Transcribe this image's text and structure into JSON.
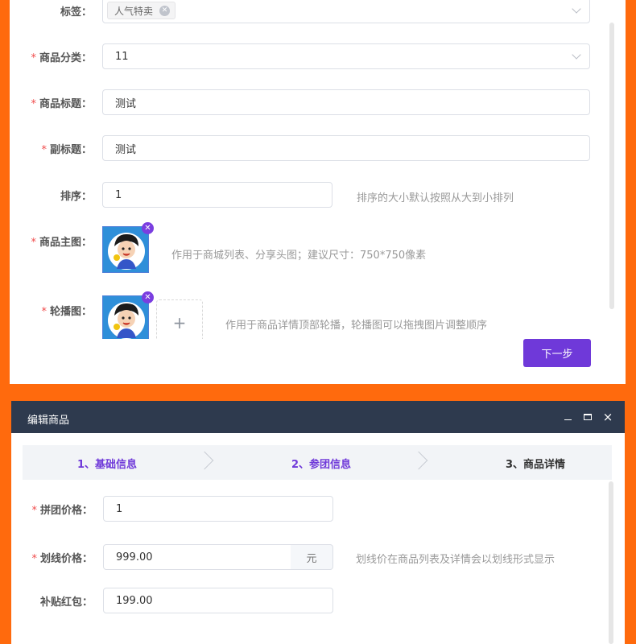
{
  "form": {
    "tags": {
      "label": "标签：",
      "items": [
        {
          "text": "人气特卖",
          "remove_icon": "close-circle-icon"
        }
      ]
    },
    "category": {
      "label": "商品分类：",
      "value": "11"
    },
    "title": {
      "label": "商品标题：",
      "value": "测试"
    },
    "subtitle": {
      "label": "副标题：",
      "value": "测试"
    },
    "sort": {
      "label": "排序：",
      "value": "1",
      "hint": "排序的大小默认按照从大到小排列"
    },
    "main_image": {
      "label": "商品主图：",
      "hint": "作用于商城列表、分享头图；建议尺寸：750*750像素"
    },
    "carousel": {
      "label": "轮播图：",
      "hint": "作用于商品详情顶部轮播，轮播图可以拖拽图片调整顺序",
      "add_symbol": "+"
    },
    "required_mark": "*",
    "next_button": "下一步"
  },
  "dialog": {
    "title": "编辑商品",
    "controls": {
      "minimize_icon": "minimize-icon",
      "maximize_icon": "maximize-icon",
      "close": "×"
    },
    "steps": [
      {
        "label": "1、基础信息",
        "state": "done"
      },
      {
        "label": "2、参团信息",
        "state": "active"
      },
      {
        "label": "3、商品详情",
        "state": "pending"
      }
    ],
    "fields": {
      "group_price": {
        "label": "拼团价格：",
        "value": "1"
      },
      "strike_price": {
        "label": "划线价格：",
        "value": "999.00",
        "suffix": "元",
        "hint": "划线价在商品列表及详情会以划线形式显示"
      },
      "subsidy": {
        "label": "补贴红包：",
        "value": "199.00"
      }
    }
  },
  "colors": {
    "page_bg": "#ff6a0d",
    "accent": "#6f39d9",
    "titlebar": "#2e3a4e",
    "required": "#f04b4b",
    "step_active": "#6f39d9",
    "step_pending": "#333333"
  }
}
